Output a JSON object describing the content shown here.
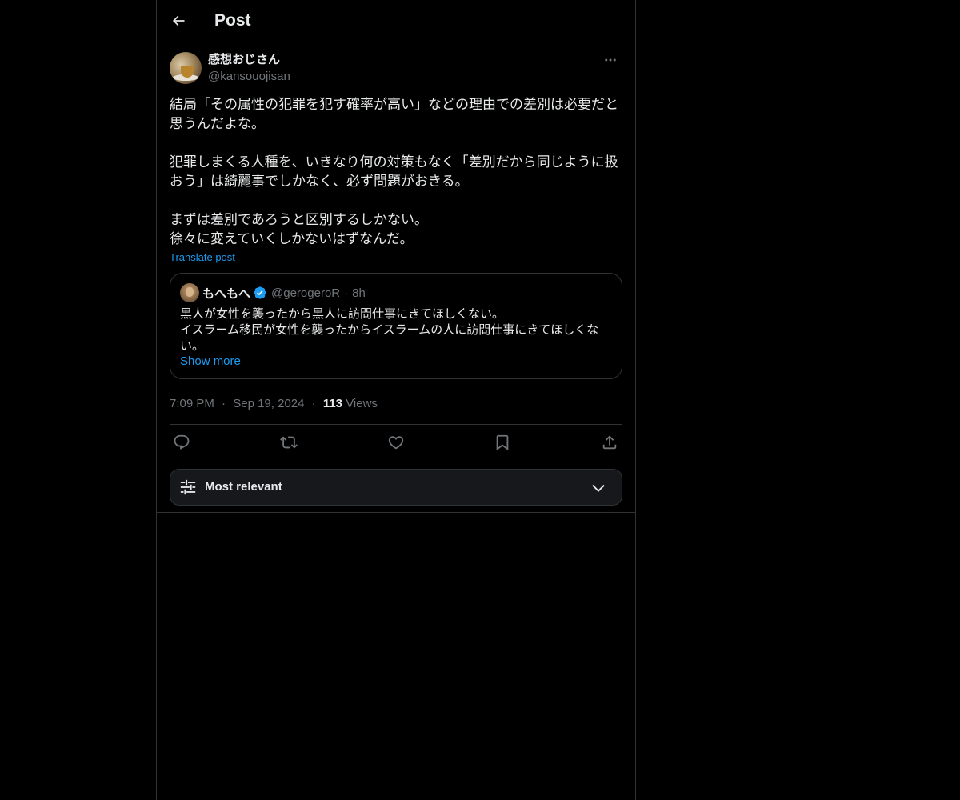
{
  "header": {
    "title": "Post"
  },
  "post": {
    "author_name": "感想おじさん",
    "author_handle": "@kansouojisan",
    "text": "結局「その属性の犯罪を犯す確率が高い」などの理由での差別は必要だと\n思うんだよな。\n\n犯罪しまくる人種を、いきなり何の対策もなく「差別だから同じように扱\nおう」は綺麗事でしかなく、必ず問題がおきる。\n\nまずは差別であろうと区別するしかない。\n徐々に変えていくしかないはずなんだ。",
    "translate_label": "Translate post",
    "time": "7:09 PM",
    "date": "Sep 19, 2024",
    "views_count": "113",
    "views_label": "Views"
  },
  "quote": {
    "name": "もへもへ",
    "handle": "@gerogeroR",
    "time": "8h",
    "text": "黒人が女性を襲ったから黒人に訪問仕事にきてほしくない。\nイスラーム移民が女性を襲ったからイスラームの人に訪問仕事にきてほしくな\nい。",
    "show_more": "Show more"
  },
  "separator": "·",
  "sort": {
    "label": "Most relevant"
  },
  "colors": {
    "background": "#000000",
    "text": "#e7e9ea",
    "muted": "#71767b",
    "accent": "#1d9bf0",
    "border": "#2f3336"
  },
  "icons": {
    "back": "arrow-left-icon",
    "more": "more-horizontal-icon",
    "verified": "verified-badge-icon",
    "reply": "reply-icon",
    "repost": "repost-icon",
    "like": "heart-icon",
    "bookmark": "bookmark-icon",
    "share": "share-icon",
    "sort": "sliders-icon",
    "chevron": "chevron-down-icon"
  }
}
